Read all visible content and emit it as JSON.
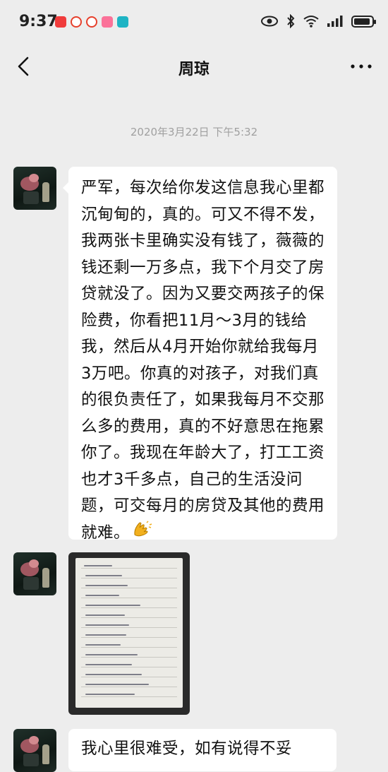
{
  "status_bar": {
    "time": "9:37",
    "app_icons": [
      {
        "name": "app-red-icon",
        "color": "#f03c3c"
      },
      {
        "name": "weibo-icon",
        "color": "#e6402c"
      },
      {
        "name": "weibo-icon-2",
        "color": "#e6402c"
      },
      {
        "name": "bilibili-icon",
        "color": "#fb7299"
      },
      {
        "name": "app-teal-icon",
        "color": "#1fb4c4"
      }
    ]
  },
  "nav": {
    "title": "周琼"
  },
  "chat": {
    "timestamp": "2020年3月22日 下午5:32",
    "messages": [
      {
        "type": "text",
        "text": "严军，每次给你发这信息我心里都沉甸甸的，真的。可又不得不发，我两张卡里确实没有钱了，薇薇的钱还剩一万多点，我下个月交了房贷就没了。因为又要交两孩子的保险费，你看把11月～3月的钱给我，然后从4月开始你就给我每月3万吧。你真的对孩子，对我们真的很负责任了，如果我每月不交那么多的费用，真的不好意思在拖累你了。我现在年龄大了，打工工资也才3千多点，自己的生活没问题，可交每月的房贷及其他的费用就难。",
        "emoji": "clap-hands"
      },
      {
        "type": "image",
        "content": "handwritten-notebook-photo"
      },
      {
        "type": "text",
        "text": "我心里很难受，如有说得不妥"
      }
    ]
  },
  "colors": {
    "background": "#ededed",
    "bubble": "#ffffff",
    "timestamp": "#a0a0a0"
  }
}
